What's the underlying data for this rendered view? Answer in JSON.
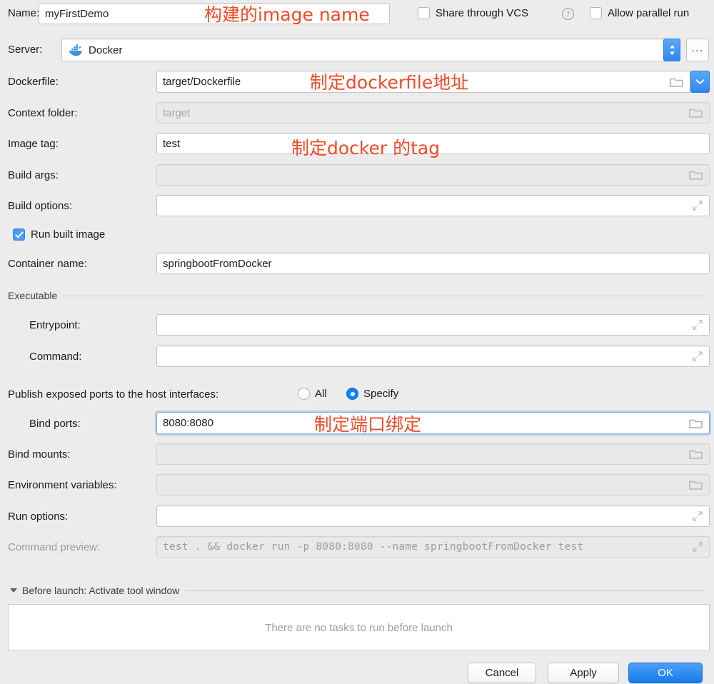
{
  "dialog": {
    "name_label": "Name:",
    "name_value": "myFirstDemo",
    "share_vcs_label": "Share through VCS",
    "help_glyph": "?",
    "allow_parallel_label": "Allow parallel run",
    "server_label": "Server:",
    "server_value": "Docker",
    "server_more_label": "...",
    "dockerfile_label": "Dockerfile:",
    "dockerfile_value": "target/Dockerfile",
    "context_label": "Context folder:",
    "context_value": "target",
    "image_tag_label": "Image tag:",
    "image_tag_value": "test",
    "build_args_label": "Build args:",
    "build_args_value": "",
    "build_options_label": "Build options:",
    "build_options_value": "",
    "run_built_image_label": "Run built image",
    "container_name_label": "Container name:",
    "container_name_value": "springbootFromDocker",
    "executable_group_label": "Executable",
    "entrypoint_label": "Entrypoint:",
    "entrypoint_value": "",
    "command_label": "Command:",
    "command_value": "",
    "publish_ports_label": "Publish exposed ports to the host interfaces:",
    "radio_all_label": "All",
    "radio_specify_label": "Specify",
    "bind_ports_label": "Bind ports:",
    "bind_ports_value": "8080:8080",
    "bind_mounts_label": "Bind mounts:",
    "bind_mounts_value": "",
    "env_vars_label": "Environment variables:",
    "env_vars_value": "",
    "run_options_label": "Run options:",
    "run_options_value": "",
    "command_preview_label": "Command preview:",
    "command_preview_value": "test . && docker run -p 8080:8080 --name springbootFromDocker test",
    "before_launch_label": "Before launch: Activate tool window",
    "before_launch_empty": "There are no tasks to run before launch",
    "cancel_label": "Cancel",
    "apply_label": "Apply",
    "ok_label": "OK"
  },
  "annotations": [
    {
      "text": "构建的image name"
    },
    {
      "text": "制定dockerfile地址"
    },
    {
      "text": "制定docker 的tag"
    },
    {
      "text": "制定端口绑定"
    }
  ],
  "colors": {
    "accent_blue": "#0a84ff",
    "annotation_red": "#f04b28",
    "background": "#ececec"
  }
}
